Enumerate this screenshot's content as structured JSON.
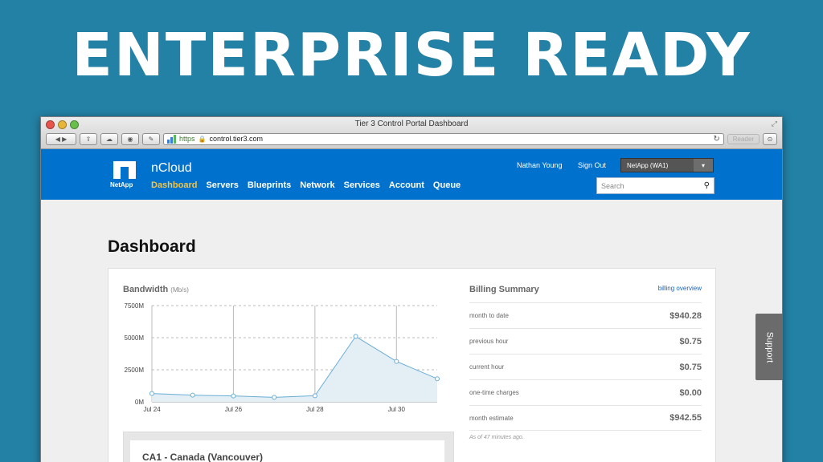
{
  "slide": {
    "title": "ENTERPRISE READY"
  },
  "browser": {
    "window_title": "Tier 3 Control Portal Dashboard",
    "url_scheme": "https",
    "url": "control.tier3.com",
    "reader_label": "Reader"
  },
  "header": {
    "logo_text": "NetApp",
    "brand": "nCloud",
    "nav": [
      "Dashboard",
      "Servers",
      "Blueprints",
      "Network",
      "Services",
      "Account",
      "Queue"
    ],
    "active_nav": "Dashboard",
    "user_name": "Nathan Young",
    "sign_out": "Sign Out",
    "account_selector": "NetApp (WA1)",
    "search_placeholder": "Search"
  },
  "page": {
    "title": "Dashboard"
  },
  "bandwidth": {
    "title": "Bandwidth",
    "unit": "(Mb/s)"
  },
  "chart_data": {
    "type": "area",
    "title": "Bandwidth",
    "ylabel": "(Mb/s)",
    "y_ticks": [
      "7500M",
      "5000M",
      "2500M",
      "0M"
    ],
    "x_ticks": [
      "Jul 24",
      "Jul 26",
      "Jul 28",
      "Jul 30"
    ],
    "ylim": [
      0,
      7500
    ],
    "x": [
      24,
      25,
      26,
      27,
      28,
      29,
      30,
      31
    ],
    "values": [
      650,
      520,
      460,
      350,
      480,
      5100,
      3150,
      1800
    ],
    "grid": true,
    "fill_color": "#e3eef5",
    "line_color": "#69aed6"
  },
  "billing": {
    "title": "Billing Summary",
    "link": "billing overview",
    "rows": [
      {
        "label": "month to date",
        "value": "$940.28"
      },
      {
        "label": "previous hour",
        "value": "$0.75"
      },
      {
        "label": "current hour",
        "value": "$0.75"
      },
      {
        "label": "one-time charges",
        "value": "$0.00"
      },
      {
        "label": "month estimate",
        "value": "$942.55"
      }
    ],
    "note": "As of 47 minutes ago."
  },
  "region": {
    "title": "CA1 - Canada (Vancouver)"
  },
  "support": {
    "label": "Support"
  }
}
